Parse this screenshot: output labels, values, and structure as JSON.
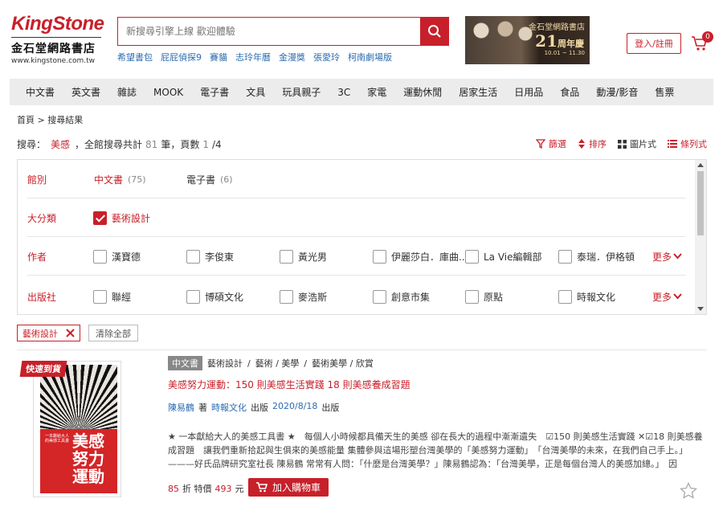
{
  "header": {
    "logo_en": "KingStone",
    "logo_zh": "金石堂網路書店",
    "logo_url": "www.kingstone.com.tw",
    "search_placeholder": "新搜尋引擎上線 歡迎體驗",
    "hot_keywords": [
      "希望書包",
      "屁屁偵探9",
      "賽貓",
      "志玲年曆",
      "金漫獎",
      "張愛玲",
      "柯南劇場版"
    ],
    "banner": {
      "line1": "金石堂網路書店",
      "line2": "21",
      "line3": "周年慶",
      "dates": "10.01 ~ 11.30"
    },
    "login_label": "登入/註冊",
    "cart_count": "0"
  },
  "nav": [
    "中文書",
    "英文書",
    "雜誌",
    "MOOK",
    "電子書",
    "文具",
    "玩具親子",
    "3C",
    "家電",
    "運動休閒",
    "居家生活",
    "日用品",
    "食品",
    "動漫/影音",
    "售票"
  ],
  "breadcrumb": "首頁 > 搜尋結果",
  "result": {
    "prefix": "搜尋：",
    "keyword": "美感",
    "mid": "，全館搜尋共計",
    "count": "81",
    "unit": "筆，頁數",
    "page": "1",
    "pages": "/4"
  },
  "tools": {
    "filter": "篩選",
    "sort": "排序",
    "grid": "圖片式",
    "list": "條列式"
  },
  "filters": {
    "library_label": "館別",
    "library": [
      {
        "name": "中文書",
        "count": "(75)"
      },
      {
        "name": "電子書",
        "count": "(6)"
      }
    ],
    "category_label": "大分類",
    "category": "藝術設計",
    "author_label": "作者",
    "authors": [
      "漢寶德",
      "李俊東",
      "黃光男",
      "伊麗莎白．庫曲...",
      "La Vie編輯部",
      "泰瑞．伊格頓"
    ],
    "publisher_label": "出版社",
    "publishers": [
      "聯經",
      "博碩文化",
      "麥浩斯",
      "創意市集",
      "原點",
      "時報文化"
    ],
    "more": "更多"
  },
  "chips": {
    "active": "藝術設計",
    "clear": "清除全部"
  },
  "product": {
    "badge": "快速到貨",
    "type": "中文書",
    "categories": [
      "藝術設計",
      "藝術 / 美學",
      "藝術美學 / 欣賞"
    ],
    "title": "美感努力運動：150 則美感生活實踐 18 則美感養成習題",
    "author": "陳易鶴",
    "author_suffix": "著",
    "publisher": "時報文化",
    "publisher_suffix": "出版",
    "date": "2020/8/18",
    "date_suffix": "出版",
    "description": "★ 一本獻給大人的美感工具書 ★　每個人小時候都具備天生的美感 卻在長大的過程中漸漸遺失　☑150 則美感生活實踐 ✕☑18 則美感養成習題　讓我們重新拾起與生俱來的美感能量 集體參與這場形塑台灣美學的「美感努力運動」　「台灣美學的未來，在我們自己手上。」———好氏品牌研究室社長 陳易鶴 常常有人問：「什麼是台灣美學？」陳易鶴認為：「台灣美學，正是每個台灣人的美感加總。」　因",
    "discount": "85",
    "discount_unit": "折 特價",
    "price": "493",
    "price_unit": "元",
    "add_cart": "加入購物車",
    "cover_title": "美感努力運動",
    "cover_sub": "一本獻給大人的美感工具書"
  },
  "colors": {
    "brand": "#c8202a",
    "link": "#2b6cb0"
  }
}
